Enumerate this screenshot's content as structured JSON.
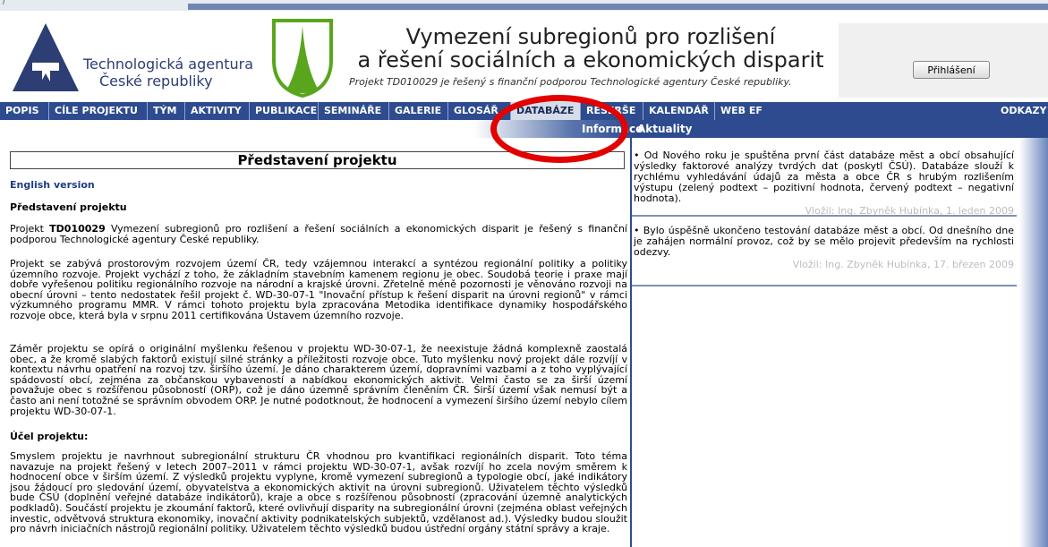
{
  "header": {
    "agency_line1": "Technologická agentura",
    "agency_line2": "České republiky",
    "title_line1": "Vymezení subregionů pro rozlišení",
    "title_line2": "a řešení sociálních a ekonomických disparit",
    "subtitle": "Projekt TD010029 je řešený s finanční podporou Technologické agentury České republiky.",
    "login_button": "Přihlášení"
  },
  "nav": {
    "items": [
      "POPIS",
      "CÍLE PROJEKTU",
      "TÝM",
      "AKTIVITY",
      "PUBLIKACE",
      "SEMINÁŘE",
      "GALERIE",
      "GLOSÁŘ",
      "DATABÁZE",
      "REŠERŠE",
      "KALENDÁŘ",
      "WEB EF",
      "ODKAZY"
    ],
    "active": "DATABÁZE"
  },
  "subnav": {
    "info": "Informace",
    "news": "Aktuality"
  },
  "main": {
    "section_title": "Představení projektu",
    "english_link": "English version",
    "heading1": "Představení projektu",
    "p1_prefix": "Projekt ",
    "p1_bold": "TD010029",
    "p1_rest": " Vymezení subregionů pro rozlišení a řešení sociálních a ekonomických disparit je řešený s finanční podporou Technologické agentury České republiky.",
    "p2": "Projekt se zabývá prostorovým rozvojem území ČR, tedy vzájemnou interakcí a syntézou regionální politiky a politiky územního rozvoje. Projekt vychází z toho, že základním stavebním kamenem regionu je obec. Soudobá teorie i praxe mají dobře vyřešenou politiku regionálního rozvoje na národní a krajské úrovni. Zřetelně méně pozornosti je věnováno rozvoji na obecní úrovni – tento nedostatek řešil projekt č. WD-30-07-1 \"Inovační přístup k řešení disparit na úrovni regionů\" v rámci výzkumného programu MMR. V rámci tohoto projektu byla zpracována Metodika identifikace dynamiky hospodářského rozvoje obce, která byla v srpnu 2011 certifikována Ústavem územního rozvoje.",
    "p3": "Záměr projektu se opírá o originální myšlenku řešenou v projektu WD-30-07-1, že neexistuje žádná komplexně zaostalá obec, a že kromě slabých faktorů existují silné stránky a příležitosti rozvoje obce. Tuto myšlenku nový projekt dále rozvíjí v kontextu návrhu opatření na rozvoj tzv. širšího území. Je dáno charakterem území, dopravními vazbami a z toho vyplývající spádovostí obcí, zejména za občanskou vybaveností a nabídkou ekonomických aktivit. Velmi často se za širší území považuje obec s rozšířenou působností (ORP), což je dáno územně správním členěním ČR. Širší území však nemusí být a často ani není totožné se správním obvodem ORP. Je nutné podotknout, že hodnocení a vymezení širšího území nebylo cílem projektu WD-30-07-1.",
    "heading2": "Účel projektu:",
    "p4": "Smyslem projektu je navrhnout subregionální strukturu ČR vhodnou pro kvantifikaci regionálních disparit. Toto téma navazuje na projekt řešený v letech 2007–2011 v rámci projektu WD-30-07-1, avšak rozvíjí ho zcela novým směrem k hodnocení obce v širším území. Z výsledků projektu vyplyne, kromě vymezení subregionů a typologie obcí, jaké indikátory jsou žádoucí pro sledování území, obyvatelstva a ekonomických aktivit na úrovni subregionů. Uživatelem těchto výsledků bude ČSÚ (doplnění veřejné databáze indikátorů), kraje a obce s rozšířenou působností (zpracování územně analytických podkladů). Součástí projektu je zkoumání faktorů, které ovlivňují disparity na subregionální úrovni (zejména oblast veřejných investic, odvětvová struktura ekonomiky, inovační aktivity podnikatelských subjektů, vzdělanost ad.). Výsledky budou sloužit pro návrh iniciačních nástrojů regionální politiky. Uživatelem těchto výsledků budou ústřední orgány státní správy a kraje."
  },
  "news": [
    {
      "text": "• Od Nového roku je spuštěna první část databáze měst a obcí obsahující výsledky faktorové analýzy tvrdých dat (poskytl ČSÚ). Databáze slouží k rychlému vyhledávání údajů za města a obce ČR s hrubým rozlišením výstupu (zelený podtext – pozitivní hodnota, červený podtext – negativní hodnota).",
      "by": "Vložil: Ing. Zbyněk Hubínka, 1. leden 2009"
    },
    {
      "text": "• Bylo úspěšně ukončeno testování databáze měst a obcí. Od dnešního dne je zahájen normální provoz, což by se mělo projevit především na rychlosti odezvy.",
      "by": "Vložil: Ing. Zbyněk Hubínka, 17. březen 2009"
    }
  ],
  "colors": {
    "nav_bg": "#2d4b8e",
    "agency_text": "#2c3e73",
    "emblem_green": "#5aa51e",
    "highlight_circle": "#e20000"
  }
}
